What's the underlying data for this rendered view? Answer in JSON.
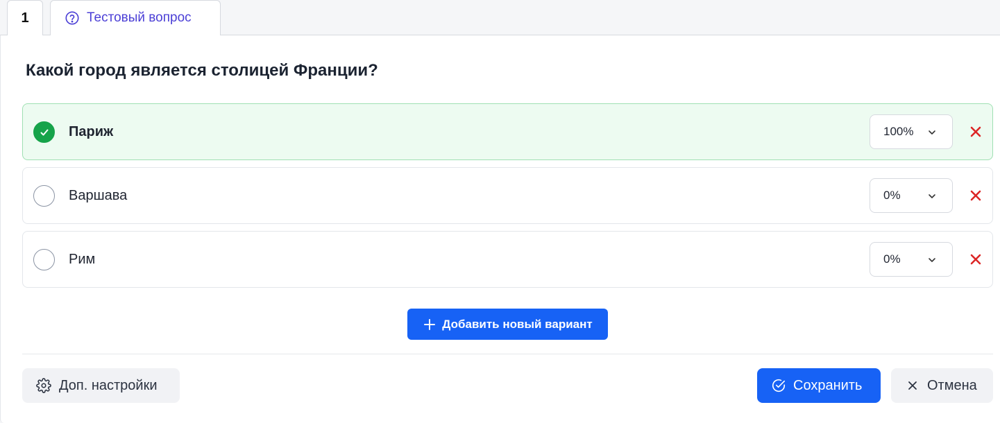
{
  "tabs": {
    "number": "1",
    "type_label": "Тестовый вопрос",
    "type_icon": "question-circle-icon"
  },
  "question": {
    "text": "Какой город является столицей Франции?"
  },
  "answers": [
    {
      "label": "Париж",
      "score": "100%",
      "correct": true
    },
    {
      "label": "Варшава",
      "score": "0%",
      "correct": false
    },
    {
      "label": "Рим",
      "score": "0%",
      "correct": false
    }
  ],
  "actions": {
    "add_label": "Добавить новый вариант",
    "settings_label": "Доп. настройки",
    "save_label": "Сохранить",
    "cancel_label": "Отмена"
  },
  "colors": {
    "accent": "#1762f5",
    "correct": "#16a34a",
    "delete": "#dc2626",
    "tab_text": "#4b3fd6"
  }
}
